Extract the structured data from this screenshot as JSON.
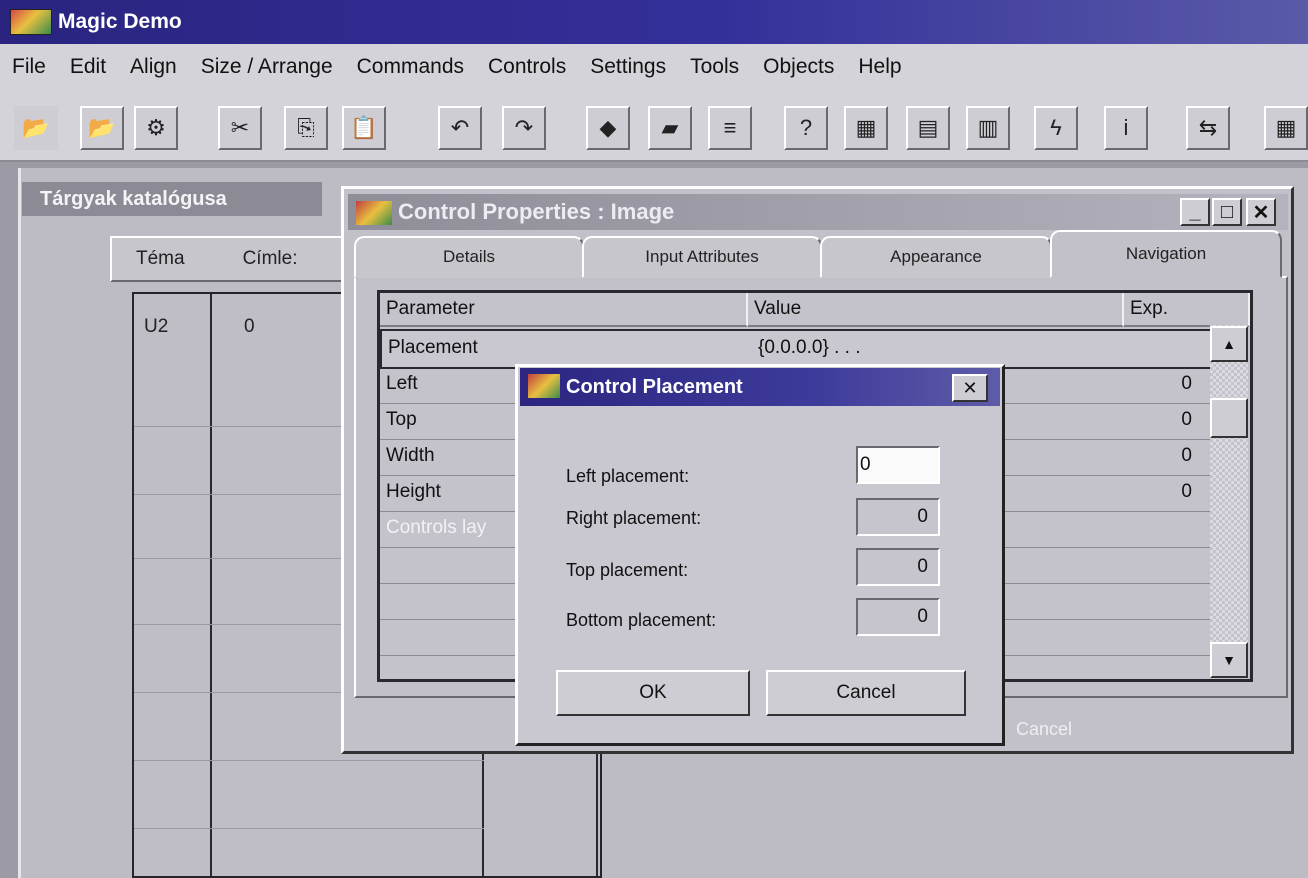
{
  "app": {
    "title": "Magic Demo"
  },
  "menu": [
    {
      "label": "File"
    },
    {
      "label": "Edit"
    },
    {
      "label": "Align"
    },
    {
      "label": "Size / Arrange"
    },
    {
      "label": "Commands"
    },
    {
      "label": "Controls"
    },
    {
      "label": "Settings"
    },
    {
      "label": "Tools"
    },
    {
      "label": "Objects"
    },
    {
      "label": "Help"
    }
  ],
  "toolbar": {
    "icons": [
      "open-folder-icon",
      "open-folder-alt-icon",
      "settings-gear-icon",
      "cut-icon",
      "copy-icon",
      "paste-icon",
      "undo-icon",
      "redo-icon",
      "shapes-icon",
      "folder-icon",
      "tree-icon",
      "help-icon",
      "image-icon",
      "form-icon",
      "table-icon",
      "lightning-icon",
      "info-icon",
      "exit-icon",
      "grid-icon"
    ],
    "glyphs": [
      "📂",
      "📂",
      "⚙",
      "✂",
      "⎘",
      "📋",
      "↶",
      "↷",
      "◆",
      "▰",
      "≡",
      "?",
      "▦",
      "▤",
      "▥",
      "ϟ",
      "i",
      "⇆",
      "▦"
    ]
  },
  "background_window": {
    "title": "Tárgyak katalógusa",
    "tabs": [
      "Téma",
      "Címle:"
    ],
    "row": {
      "col1": "U2",
      "col2": "0"
    }
  },
  "control_properties": {
    "title": "Control Properties : Image",
    "tabs": [
      "Details",
      "Input Attributes",
      "Appearance",
      "Navigation"
    ],
    "active_tab": "Navigation",
    "columns": [
      "Parameter",
      "Value",
      "Exp."
    ],
    "rows": [
      {
        "param": "Placement",
        "value": "{0.0.0.0} . . .",
        "exp": ""
      },
      {
        "param": "Left",
        "value": "",
        "exp": "0"
      },
      {
        "param": "Top",
        "value": "",
        "exp": "0"
      },
      {
        "param": "Width",
        "value": "",
        "exp": "0"
      },
      {
        "param": "Height",
        "value": "",
        "exp": "0"
      },
      {
        "param": "Controls lay",
        "value": "",
        "exp": ""
      }
    ],
    "cancel_label": "Cancel"
  },
  "control_placement": {
    "title": "Control Placement",
    "fields": [
      {
        "label": "Left placement:",
        "value": "0"
      },
      {
        "label": "Right placement:",
        "value": "0"
      },
      {
        "label": "Top placement:",
        "value": "0"
      },
      {
        "label": "Bottom placement:",
        "value": "0"
      }
    ],
    "ok_label": "OK",
    "cancel_label": "Cancel"
  }
}
